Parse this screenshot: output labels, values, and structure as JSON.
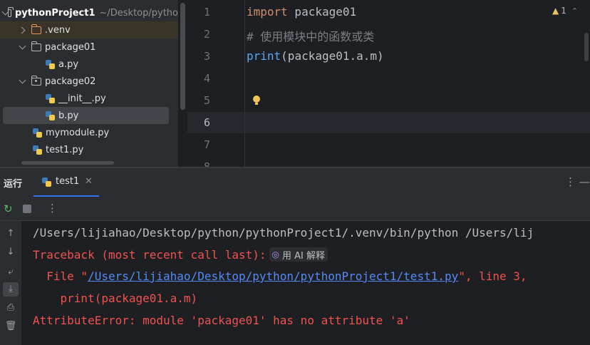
{
  "project_tree": {
    "project_name": "pythonProject1",
    "project_path": "~/Desktop/pytho",
    "items": [
      {
        "label": ".venv"
      },
      {
        "label": "package01"
      },
      {
        "label": "a.py"
      },
      {
        "label": "package02"
      },
      {
        "label": "__init__.py"
      },
      {
        "label": "b.py"
      },
      {
        "label": "mymodule.py"
      },
      {
        "label": "test1.py"
      }
    ]
  },
  "editor": {
    "line_numbers": [
      "1",
      "2",
      "3",
      "4",
      "5",
      "6",
      "7",
      "8"
    ],
    "line1_keyword": "import",
    "line1_rest": " package01",
    "line2_comment": "# 使用模块中的函数或类",
    "line3_fn": "print",
    "line3_rest": "(package01.a.m)",
    "warning_count": "1"
  },
  "run_panel": {
    "title": "运行",
    "tab_label": "test1",
    "console": {
      "line1": "/Users/lijiahao/Desktop/python/pythonProject1/.venv/bin/python /Users/lij",
      "line2": "Traceback (most recent call last):",
      "ai_label": "用 AI 解释",
      "line3_prefix": "  File \"",
      "line3_link": "/Users/lijiahao/Desktop/python/pythonProject1/test1.py",
      "line3_suffix": "\", line 3, ",
      "line4": "    print(package01.a.m)",
      "line5": "AttributeError: module 'package01' has no attribute 'a'"
    }
  },
  "colors": {
    "error": "#f0524f",
    "link": "#548af7",
    "keyword": "#cf8e6d",
    "function": "#56a8f5",
    "accent": "#3574f0"
  }
}
